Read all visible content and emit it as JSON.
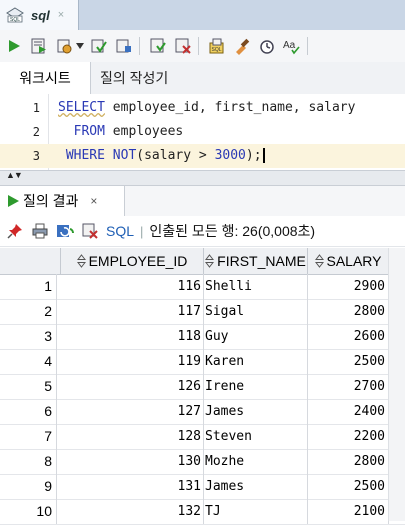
{
  "document_tab": {
    "label": "sql",
    "close": "×"
  },
  "subtabs": {
    "worksheet": "워크시트",
    "query_builder": "질의 작성기"
  },
  "editor": {
    "line_numbers": [
      "1",
      "2",
      "3"
    ],
    "line1": {
      "kw1": "SELECT",
      "rest": " employee_id, first_name, salary"
    },
    "line2": {
      "indent": "  ",
      "kw": "FROM",
      "rest": " employees"
    },
    "line3": {
      "indent": " ",
      "kw1": "WHERE",
      "sp": " ",
      "kw2": "NOT",
      "open": "(salary > ",
      "num": "3000",
      "close": ");"
    }
  },
  "result_tab": {
    "label": "질의 결과",
    "close": "×"
  },
  "result_toolbar": {
    "sql_label": "SQL",
    "separator": "|",
    "fetched_text": "인출된 모든 행: 26(0,008초)"
  },
  "grid": {
    "columns": [
      "EMPLOYEE_ID",
      "FIRST_NAME",
      "SALARY"
    ],
    "rows": [
      {
        "n": "1",
        "id": "116",
        "name": "Shelli",
        "salary": "2900"
      },
      {
        "n": "2",
        "id": "117",
        "name": "Sigal",
        "salary": "2800"
      },
      {
        "n": "3",
        "id": "118",
        "name": "Guy",
        "salary": "2600"
      },
      {
        "n": "4",
        "id": "119",
        "name": "Karen",
        "salary": "2500"
      },
      {
        "n": "5",
        "id": "126",
        "name": "Irene",
        "salary": "2700"
      },
      {
        "n": "6",
        "id": "127",
        "name": "James",
        "salary": "2400"
      },
      {
        "n": "7",
        "id": "128",
        "name": "Steven",
        "salary": "2200"
      },
      {
        "n": "8",
        "id": "130",
        "name": "Mozhe",
        "salary": "2800"
      },
      {
        "n": "9",
        "id": "131",
        "name": "James",
        "salary": "2500"
      },
      {
        "n": "10",
        "id": "132",
        "name": "TJ",
        "salary": "2100"
      }
    ]
  },
  "icons": {
    "toolbar": [
      "run-statement-icon",
      "run-script-icon",
      "commit-icon",
      "dropdown-icon",
      "autotrace-icon",
      "explain-plan-icon",
      "sql-tuning-icon",
      "rollback-icon",
      "sql-history-icon",
      "clear-icon",
      "find-icon",
      "format-icon"
    ]
  },
  "colors": {
    "keyword": "#2a39b5",
    "current_line": "#fbf4dd",
    "tab_bar": "#c9d6e6",
    "link": "#1f5fb5"
  }
}
